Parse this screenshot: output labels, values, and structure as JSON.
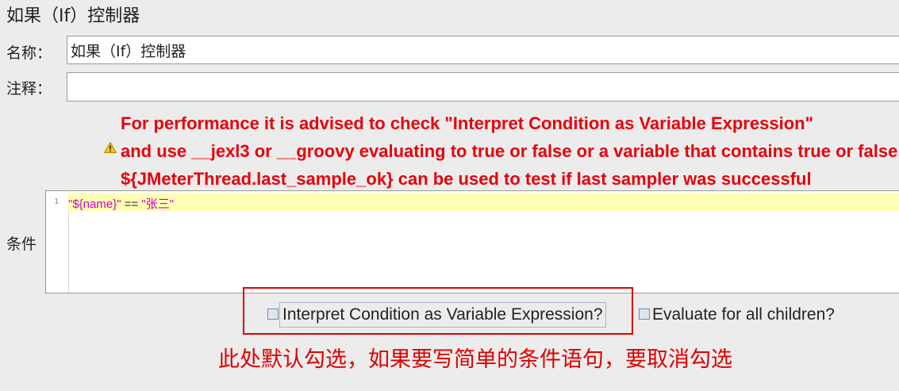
{
  "panel": {
    "title": "如果（If）控制器"
  },
  "name_field": {
    "label": "名称：",
    "value": "如果（If）控制器"
  },
  "comment_field": {
    "label": "注释：",
    "value": ""
  },
  "warning": {
    "icon": "warning-triangle-icon",
    "lines": [
      "For performance it is advised to check \"Interpret Condition as Variable Expression\"",
      "and use __jexl3 or __groovy evaluating to true or false or a variable that contains true or false.",
      "${JMeterThread.last_sample_ok} can be used to test if last sampler was successful"
    ],
    "color": "#e8000b"
  },
  "condition": {
    "label": "条件",
    "line_number": "1",
    "code": {
      "left": "\"${name}\"",
      "operator": " == ",
      "right": "\"张三\""
    }
  },
  "options": {
    "interpret_as_variable": {
      "label": "Interpret Condition as Variable Expression?",
      "checked": false
    },
    "evaluate_all_children": {
      "label": "Evaluate for all children?",
      "checked": false
    }
  },
  "annotation": {
    "text": "此处默认勾选，如果要写简单的条件语句，要取消勾选",
    "color": "#e00000"
  }
}
